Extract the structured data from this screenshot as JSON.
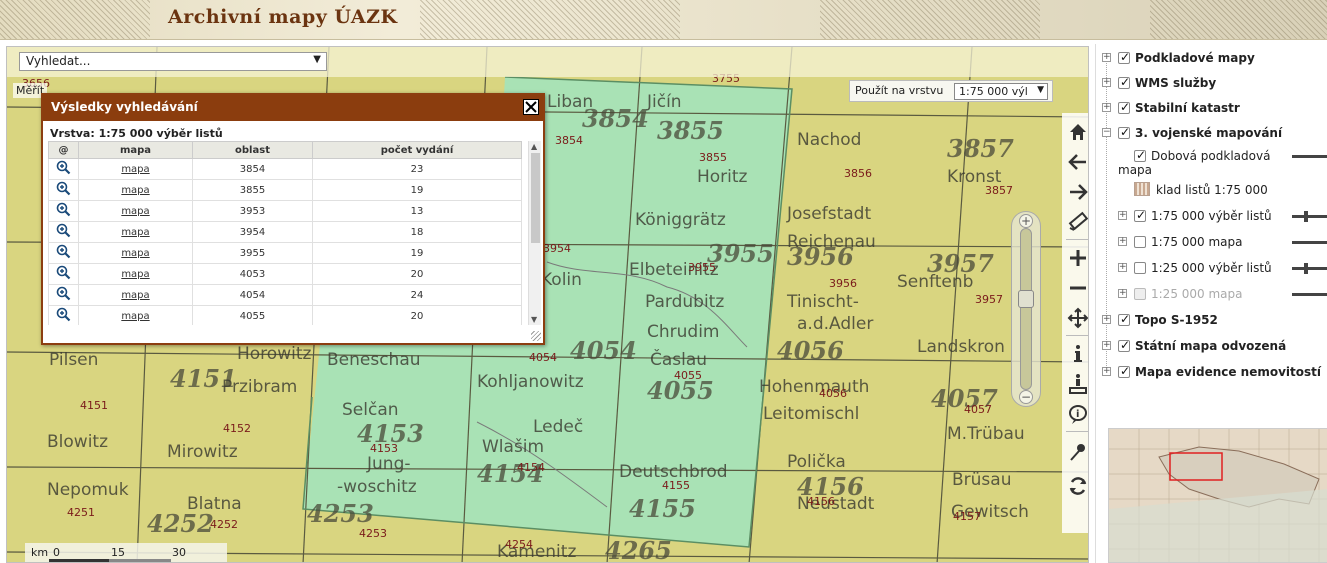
{
  "header": {
    "title": "Archivní mapy ÚAZK"
  },
  "search": {
    "placeholder": "Vyhledat..."
  },
  "scale_label": "Měřít",
  "layer_picker": {
    "label": "Použít na vrstvu",
    "selected": "1:75 000 výl"
  },
  "results_panel": {
    "title": "Výsledky vyhledávání",
    "layer_line": "Vrstva: 1:75 000 výběr listů",
    "columns": [
      "@",
      "mapa",
      "oblast",
      "počet vydání"
    ],
    "rows": [
      {
        "link": "mapa",
        "oblast": "3854",
        "count": "23"
      },
      {
        "link": "mapa",
        "oblast": "3855",
        "count": "19"
      },
      {
        "link": "mapa",
        "oblast": "3953",
        "count": "13"
      },
      {
        "link": "mapa",
        "oblast": "3954",
        "count": "18"
      },
      {
        "link": "mapa",
        "oblast": "3955",
        "count": "19"
      },
      {
        "link": "mapa",
        "oblast": "4053",
        "count": "20"
      },
      {
        "link": "mapa",
        "oblast": "4054",
        "count": "24"
      },
      {
        "link": "mapa",
        "oblast": "4055",
        "count": "20"
      }
    ],
    "close_symbol": "✕"
  },
  "scalebar": {
    "unit": "km",
    "ticks": [
      "0",
      "15",
      "30"
    ]
  },
  "map_labels": {
    "sheet_numbers": [
      "3854",
      "3855",
      "3856",
      "3857",
      "3954",
      "3955",
      "3956",
      "3957",
      "4054",
      "4055",
      "4056",
      "4057",
      "4151",
      "4152",
      "4153",
      "4154",
      "4155",
      "4156",
      "4157",
      "4251",
      "4252",
      "4253",
      "4254",
      "3755",
      "3656"
    ],
    "place_names": [
      "Jičín",
      "Horitz",
      "Liban",
      "Nachod",
      "Königgrätz",
      "Elbeteinitz",
      "Pardubitz",
      "Josefstadt",
      "Reichenau",
      "Senftenberg",
      "Tinischt a.d.Adler",
      "Chrudim",
      "Časlau",
      "Kohljanowitz",
      "Beneschau",
      "Hohenmauth",
      "Leitomischl",
      "Landskron",
      "Pilsen",
      "Przibram",
      "Blowitz",
      "Mirowitz",
      "Selčan",
      "Jung-woschitz",
      "Wlašim",
      "Ledeč",
      "Deutschbrod",
      "Polička",
      "Neustadt",
      "Brüsau",
      "M.Trübau",
      "Gewitsch",
      "Nepomuk",
      "Blatna",
      "Kamenitz",
      "Kolin",
      "Horowitz",
      "Kronstadt"
    ]
  },
  "sidebar": {
    "items": [
      {
        "label": "Podkladové mapy",
        "checked": true,
        "bold": true,
        "level": 0,
        "expander": "+"
      },
      {
        "label": "WMS služby",
        "checked": true,
        "bold": true,
        "level": 0,
        "expander": "+"
      },
      {
        "label": "Stabilní katastr",
        "checked": true,
        "bold": true,
        "level": 0,
        "expander": "+"
      },
      {
        "label": "3. vojenské mapování",
        "checked": true,
        "bold": true,
        "level": 0,
        "expander": "−"
      },
      {
        "label": "Dobová podkladová",
        "checked": true,
        "bold": false,
        "level": 1
      },
      {
        "label": "mapa",
        "level": 1
      },
      {
        "label": "klad listů 1:75 000",
        "level": 2
      },
      {
        "label": "1:75 000 výběr listů",
        "checked": true,
        "level": 1,
        "expander": "+"
      },
      {
        "label": "1:75 000 mapa",
        "checked": false,
        "level": 1,
        "expander": "+"
      },
      {
        "label": "1:25 000 výběr listů",
        "checked": false,
        "level": 1,
        "expander": "+"
      },
      {
        "label": "1:25 000 mapa",
        "checked": false,
        "disabled": true,
        "level": 1,
        "expander": "+"
      },
      {
        "label": "Topo S-1952",
        "checked": true,
        "bold": true,
        "level": 0,
        "expander": "+"
      },
      {
        "label": "Státní mapa odvozená",
        "checked": true,
        "bold": true,
        "level": 0,
        "expander": "+"
      },
      {
        "label": "Mapa evidence nemovitostí",
        "checked": true,
        "bold": true,
        "level": 0,
        "expander": "+"
      }
    ]
  },
  "colors": {
    "header_title": "#6b3410",
    "results_titlebar": "#8b3d0e",
    "map_yellow": "#d6d27c",
    "map_green": "#a9e4b6",
    "sheet_number": "#7a1a1a",
    "highlight_box": "#e02020"
  },
  "icons": [
    "home-icon",
    "arrow-left-icon",
    "arrow-right-icon",
    "ruler-icon",
    "zoom-in-icon",
    "zoom-out-icon",
    "pan-icon",
    "info-icon",
    "identify-icon",
    "info-balloon-icon",
    "pin-icon",
    "refresh-icon",
    "magnifier-icon",
    "close-icon"
  ]
}
